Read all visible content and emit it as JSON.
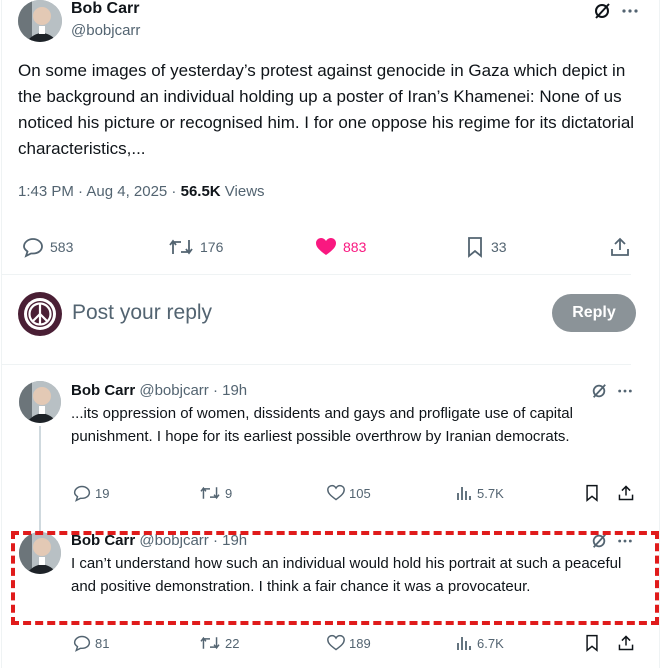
{
  "main_tweet": {
    "name": "Bob Carr",
    "handle": "@bobjcarr",
    "text": "On some images of yesterday’s protest against genocide in Gaza which depict in the background an individual holding up a poster of Iran’s Khamenei: None of us noticed his picture or recognised him. I for one oppose his regime for its dictatorial characteristics,...",
    "time": "1:43 PM · Aug 4, 2025 · ",
    "views_count": "56.5K",
    "views_label": " Views",
    "replies": "583",
    "reposts": "176",
    "likes": "883",
    "bookmarks": "33"
  },
  "composer": {
    "placeholder": "Post your reply",
    "button": "Reply"
  },
  "replies": [
    {
      "name": "Bob Carr",
      "handle": "@bobjcarr · 19h",
      "text": "...its oppression of women, dissidents and gays and profligate use of capital punishment. I hope for its earliest possible overthrow by Iranian democrats.",
      "replies": "19",
      "reposts": "9",
      "likes": "105",
      "views": "5.7K"
    },
    {
      "name": "Bob Carr",
      "handle": "@bobjcarr · 19h",
      "text": "I can’t understand how such an individual would hold his portrait at such a peaceful and positive demonstration. I think a fair chance it was a provocateur.",
      "replies": "81",
      "reposts": "22",
      "likes": "189",
      "views": "6.7K"
    }
  ],
  "colors": {
    "text": "#0f1419",
    "muted": "#536471",
    "like": "#f91880",
    "highlight": "#e01b1b",
    "reply_button": "#8b9398"
  }
}
